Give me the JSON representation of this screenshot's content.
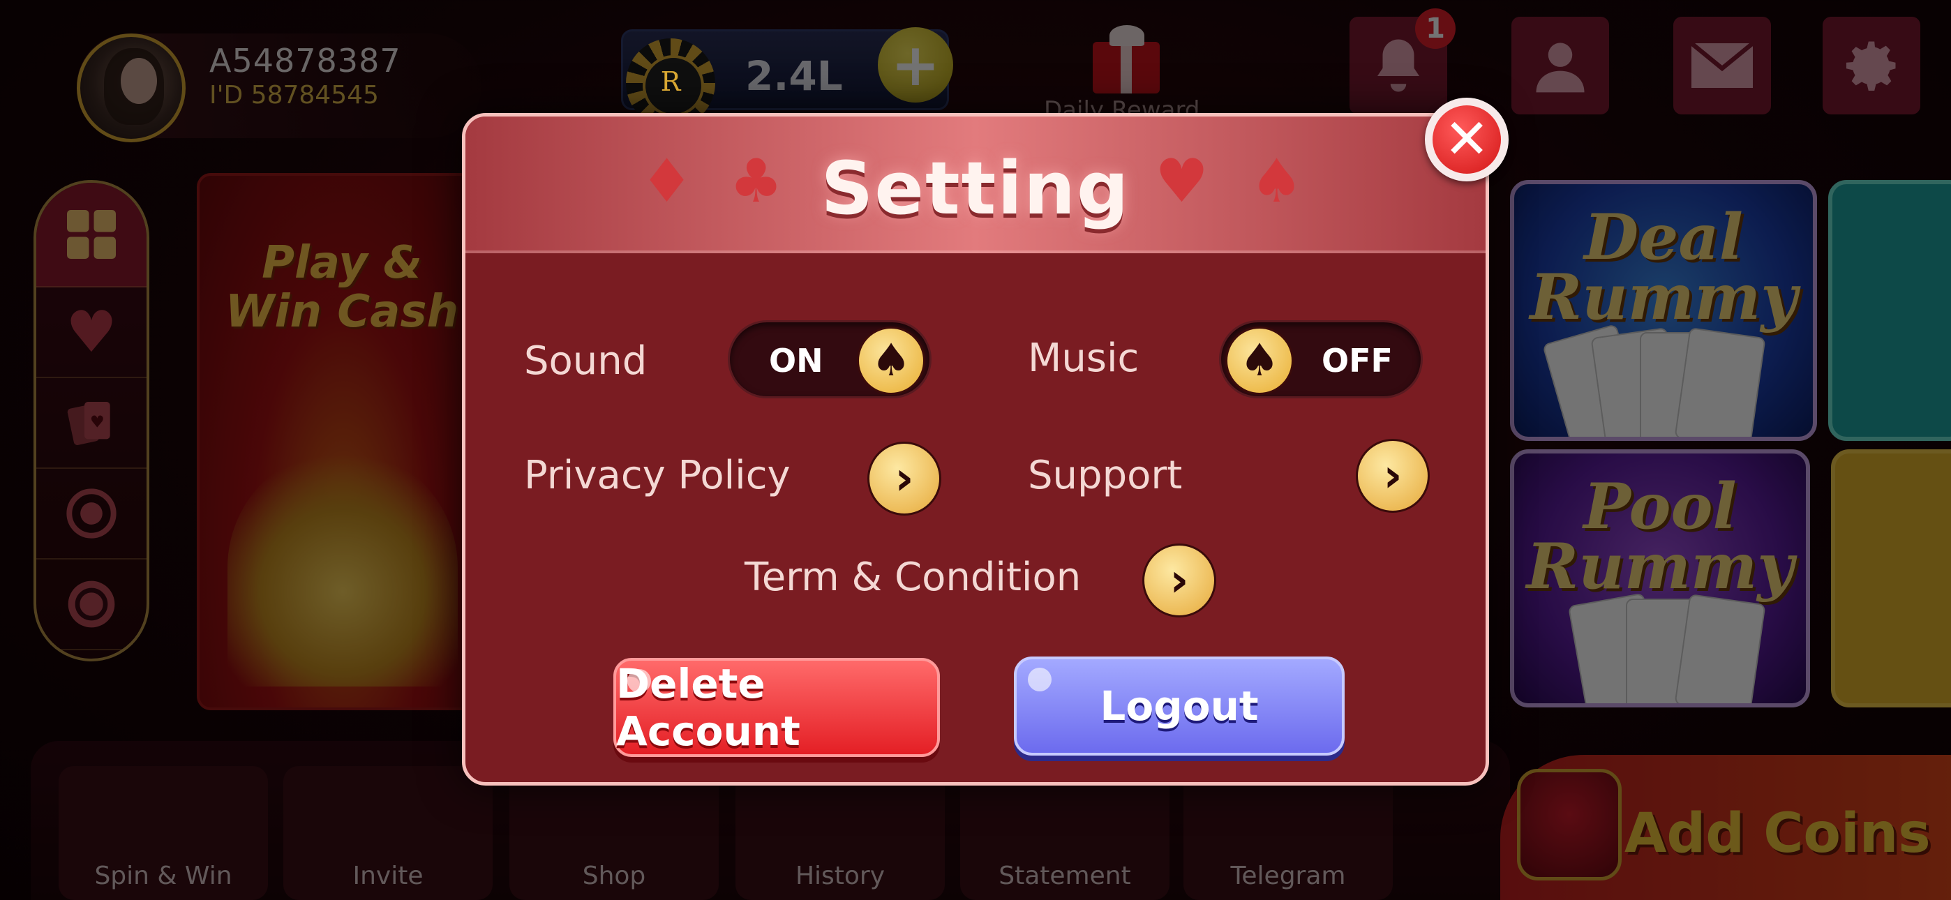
{
  "profile": {
    "username": "A54878387",
    "id_label": "I'D 58784545"
  },
  "wallet": {
    "balance": "2.4L",
    "chip_letter": "R"
  },
  "daily_reward": "Daily Reward",
  "notifications": {
    "count": "1"
  },
  "promo": {
    "title": "Play & Win Cash"
  },
  "games": [
    {
      "name": "Deal Rummy"
    },
    {
      "name": "Pool Rummy"
    }
  ],
  "bottom_nav": [
    {
      "label": "Spin & Win"
    },
    {
      "label": "Invite"
    },
    {
      "label": "Shop"
    },
    {
      "label": "History"
    },
    {
      "label": "Statement"
    },
    {
      "label": "Telegram"
    }
  ],
  "add_coins": "Add Coins",
  "settings_modal": {
    "title": "Setting",
    "sound": {
      "label": "Sound",
      "state": "ON"
    },
    "music": {
      "label": "Music",
      "state": "OFF"
    },
    "privacy": {
      "label": "Privacy Policy"
    },
    "support": {
      "label": "Support"
    },
    "terms": {
      "label": "Term & Condition"
    },
    "delete_label": "Delete Account",
    "logout_label": "Logout"
  },
  "colors": {
    "modal_bg": "#7a1c22",
    "accent_gold": "#e9ae32",
    "delete_red": "#e41f25",
    "logout_blue": "#6c6bee"
  }
}
